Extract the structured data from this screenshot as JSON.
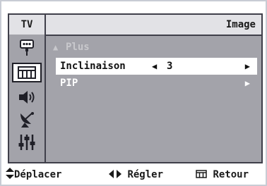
{
  "header": {
    "mode": "TV",
    "title": "Image"
  },
  "sidebar": {
    "items": [
      {
        "icon": "input-source-icon",
        "active": false
      },
      {
        "icon": "picture-icon",
        "active": true
      },
      {
        "icon": "sound-icon",
        "active": false
      },
      {
        "icon": "channel-antenna-icon",
        "active": false
      },
      {
        "icon": "setup-sliders-icon",
        "active": false
      }
    ]
  },
  "menu": {
    "plus_label": "Plus",
    "tilt_label": "Inclinaison",
    "tilt_value": "3",
    "pip_label": "PIP"
  },
  "footer": {
    "move_label": "Déplacer",
    "adjust_label": "Régler",
    "back_label": "Retour"
  },
  "colors": {
    "panel": "#a3a3aa",
    "header": "#e2e2e6",
    "highlight": "#ffffff",
    "border": "#3f3f4a"
  }
}
